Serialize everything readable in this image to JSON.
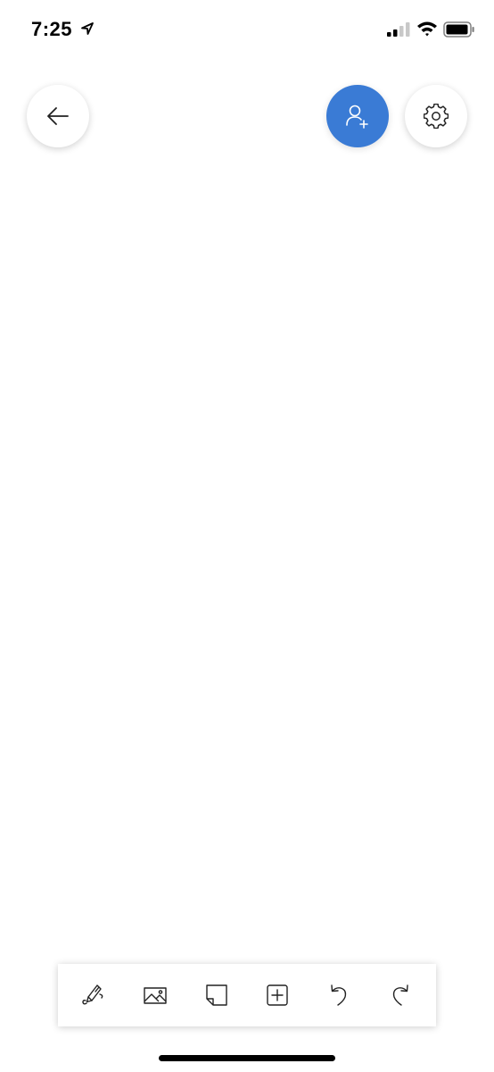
{
  "status_bar": {
    "time": "7:25",
    "icons": [
      "location-arrow-icon",
      "cellular-signal-icon",
      "wifi-icon",
      "battery-icon"
    ]
  },
  "header": {
    "back_icon": "arrow-left-icon",
    "share_icon": "add-person-icon",
    "settings_icon": "gear-icon"
  },
  "toolbar": {
    "items": [
      {
        "icon": "pen-icon"
      },
      {
        "icon": "image-icon"
      },
      {
        "icon": "sticky-note-icon"
      },
      {
        "icon": "add-box-icon"
      },
      {
        "icon": "undo-icon"
      },
      {
        "icon": "redo-icon"
      }
    ]
  },
  "colors": {
    "accent": "#3a7bd5",
    "background": "#ffffff",
    "icon": "#222222"
  }
}
